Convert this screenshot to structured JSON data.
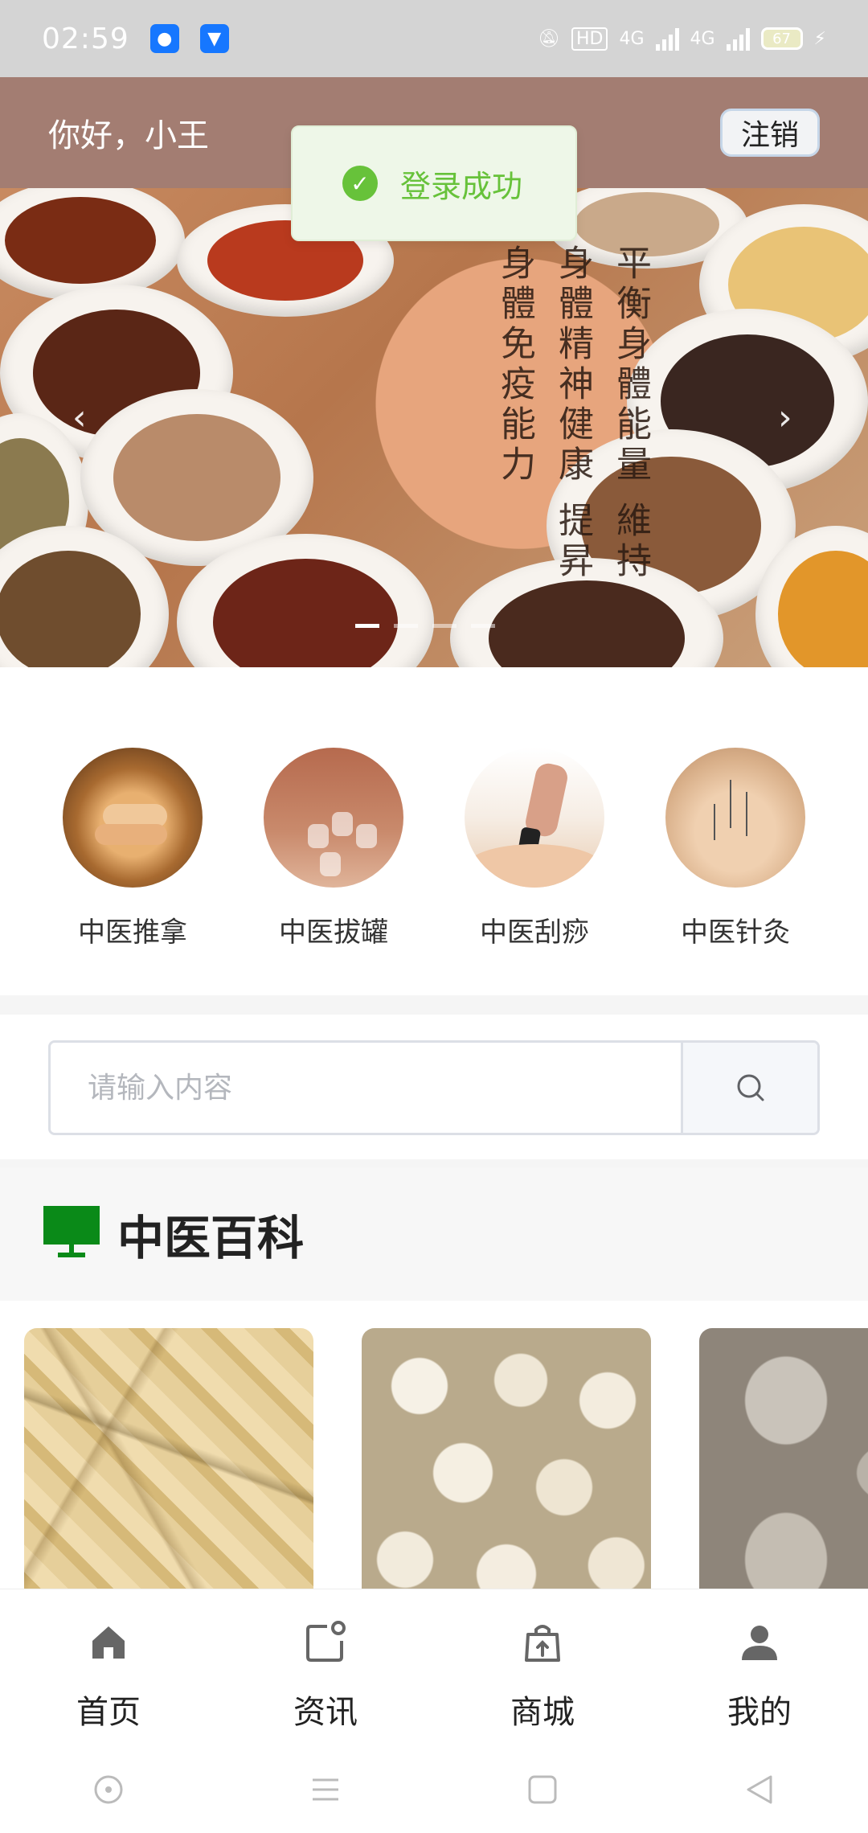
{
  "status_bar": {
    "time": "02:59",
    "network_label": "HD",
    "signal1": "4G",
    "signal2": "4G",
    "battery": "67"
  },
  "header": {
    "greeting": "你好，小王",
    "logout_label": "注销",
    "background_color": "#a37d72"
  },
  "toast": {
    "message": "登录成功",
    "color": "#67c23a"
  },
  "banner": {
    "scroll_text": "平衡身體能量 維持身體精神健康 提昇身體免疫能力",
    "active_index": 0,
    "slide_count": 4
  },
  "categories": [
    {
      "label": "中医推拿",
      "icon": "massage-image"
    },
    {
      "label": "中医拔罐",
      "icon": "cupping-image"
    },
    {
      "label": "中医刮痧",
      "icon": "guasha-image"
    },
    {
      "label": "中医针灸",
      "icon": "acupuncture-image"
    }
  ],
  "search": {
    "placeholder": "请输入内容",
    "button_icon": "search-icon"
  },
  "section": {
    "title": "中医百科",
    "icon": "monitor-icon",
    "icon_color": "#0a8a18"
  },
  "tabbar": [
    {
      "label": "首页",
      "icon": "home-icon"
    },
    {
      "label": "资讯",
      "icon": "news-icon"
    },
    {
      "label": "商城",
      "icon": "shop-icon"
    },
    {
      "label": "我的",
      "icon": "user-icon"
    }
  ],
  "navbar": [
    "assistant-button",
    "menu-button",
    "home-button",
    "back-button"
  ]
}
